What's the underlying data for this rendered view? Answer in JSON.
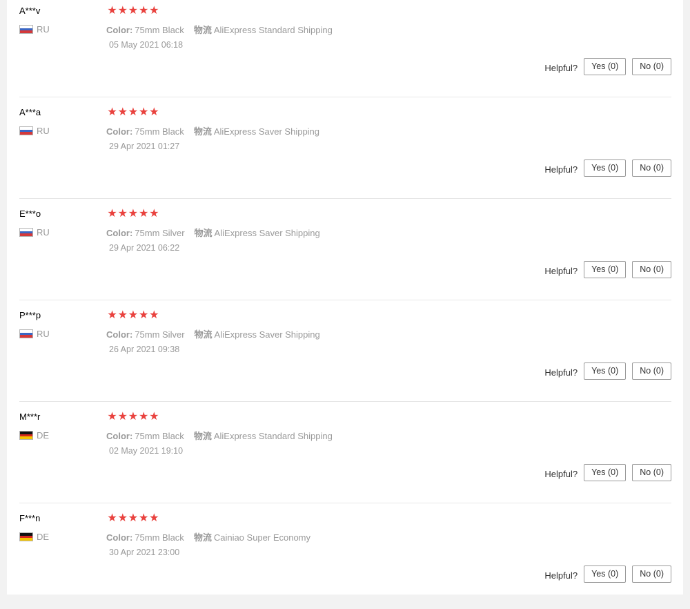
{
  "helpful_label": "Helpful?",
  "color_label": "Color:",
  "shipping_label": "物流",
  "star_color": "#e9423e",
  "rating_icon": "star-icon",
  "reviews": [
    {
      "user": "A***v",
      "country": "RU",
      "rating": 5,
      "color": "75mm Black",
      "shipping": "AliExpress Standard Shipping",
      "date": "05 May 2021 06:18",
      "yes": "Yes (0)",
      "no": "No (0)"
    },
    {
      "user": "A***a",
      "country": "RU",
      "rating": 5,
      "color": "75mm Black",
      "shipping": "AliExpress Saver Shipping",
      "date": "29 Apr 2021 01:27",
      "yes": "Yes (0)",
      "no": "No (0)"
    },
    {
      "user": "E***o",
      "country": "RU",
      "rating": 5,
      "color": "75mm Silver",
      "shipping": "AliExpress Saver Shipping",
      "date": "29 Apr 2021 06:22",
      "yes": "Yes (0)",
      "no": "No (0)"
    },
    {
      "user": "P***p",
      "country": "RU",
      "rating": 5,
      "color": "75mm Silver",
      "shipping": "AliExpress Saver Shipping",
      "date": "26 Apr 2021 09:38",
      "yes": "Yes (0)",
      "no": "No (0)"
    },
    {
      "user": "M***r",
      "country": "DE",
      "rating": 5,
      "color": "75mm Black",
      "shipping": "AliExpress Standard Shipping",
      "date": "02 May 2021 19:10",
      "yes": "Yes (0)",
      "no": "No (0)"
    },
    {
      "user": "F***n",
      "country": "DE",
      "rating": 5,
      "color": "75mm Black",
      "shipping": "Cainiao Super Economy",
      "date": "30 Apr 2021 23:00",
      "yes": "Yes (0)",
      "no": "No (0)"
    }
  ]
}
